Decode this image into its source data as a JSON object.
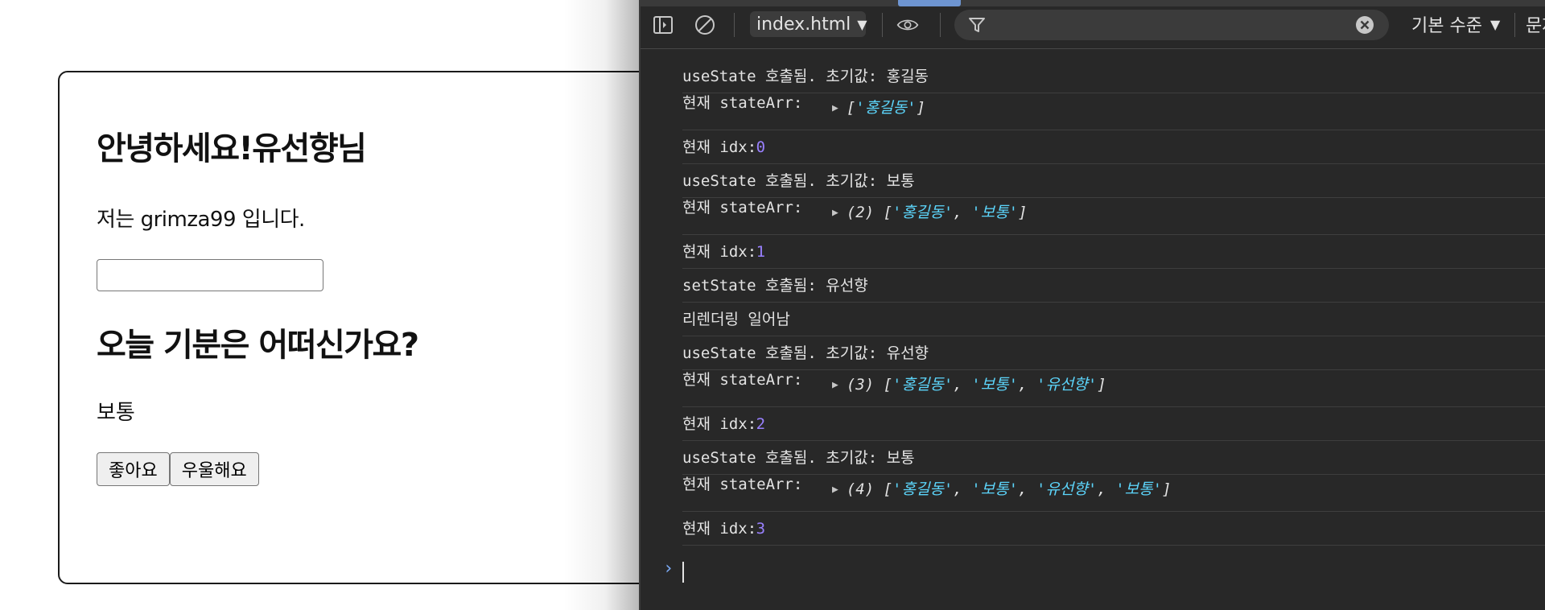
{
  "app": {
    "greeting": "안녕하세요!유선향님",
    "intro": "저는 grimza99 입니다.",
    "name_input_value": "",
    "question": "오늘 기분은 어떠신가요?",
    "mood": "보통",
    "buttons": {
      "good": "좋아요",
      "sad": "우울해요"
    }
  },
  "devtools": {
    "context": "index.html",
    "filter_placeholder": "",
    "levels": "기본 수준",
    "extra_label": "문제",
    "icons": [
      "sidebar-toggle-icon",
      "clear-console-icon",
      "eye-icon",
      "filter-icon",
      "clear-filter-icon"
    ],
    "accent_color": "#7cacf8",
    "string_color": "#5cd5fb",
    "number_color": "#9980ff",
    "logs": [
      {
        "text": "useState 호출됨. 초기값: 홍길동"
      },
      {
        "label": "현재 stateArr: ",
        "count": "",
        "values": [
          "'홍길동'"
        ]
      },
      {
        "label": "현재 idx: ",
        "idx": "0"
      },
      {
        "text": "useState 호출됨. 초기값: 보통"
      },
      {
        "label": "현재 stateArr: ",
        "count": "(2) ",
        "values": [
          "'홍길동'",
          "'보통'"
        ]
      },
      {
        "label": "현재 idx: ",
        "idx": "1"
      },
      {
        "text": "setState 호출됨: 유선향"
      },
      {
        "text": "리렌더링 일어남"
      },
      {
        "text": "useState 호출됨. 초기값: 유선향"
      },
      {
        "label": "현재 stateArr: ",
        "count": "(3) ",
        "values": [
          "'홍길동'",
          "'보통'",
          "'유선향'"
        ]
      },
      {
        "label": "현재 idx: ",
        "idx": "2"
      },
      {
        "text": "useState 호출됨. 초기값: 보통"
      },
      {
        "label": "현재 stateArr: ",
        "count": "(4) ",
        "values": [
          "'홍길동'",
          "'보통'",
          "'유선향'",
          "'보통'"
        ]
      },
      {
        "label": "현재 idx: ",
        "idx": "3"
      }
    ],
    "prompt_symbol": "›"
  }
}
